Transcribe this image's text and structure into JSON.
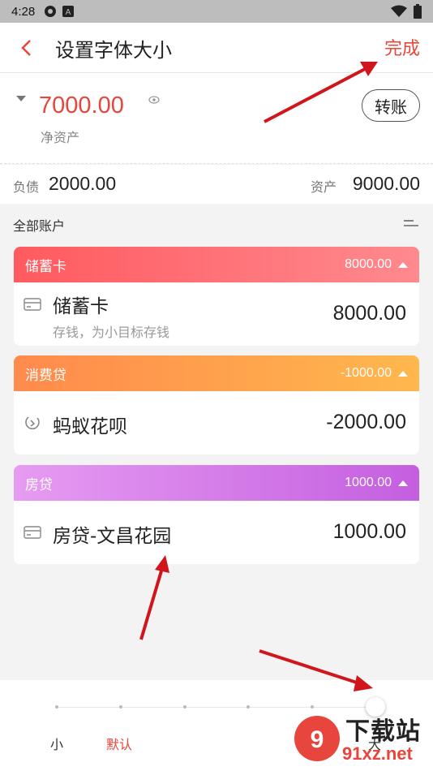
{
  "status_bar": {
    "time": "4:28"
  },
  "app_bar": {
    "title": "设置字体大小",
    "done_label": "完成"
  },
  "summary": {
    "net_assets_value": "7000.00",
    "net_assets_label": "净资产",
    "transfer_label": "转账"
  },
  "totals": {
    "liabilities_label": "负债",
    "liabilities_value": "2000.00",
    "assets_label": "资产",
    "assets_value": "9000.00"
  },
  "accounts_section": {
    "label": "全部账户"
  },
  "groups": [
    {
      "name": "储蓄卡",
      "amount": "8000.00",
      "color_from": "#ff5a5f",
      "color_to": "#ff8a8f",
      "account": {
        "name": "储蓄卡",
        "subtitle": "存钱，为小目标存钱",
        "value": "8000.00",
        "icon": "card-icon"
      }
    },
    {
      "name": "消费贷",
      "amount": "-1000.00",
      "color_from": "#ff8a4d",
      "color_to": "#ffb84d",
      "account": {
        "name": "蚂蚁花呗",
        "subtitle": "",
        "value": "-2000.00",
        "icon": "huabei-icon"
      }
    },
    {
      "name": "房贷",
      "amount": "1000.00",
      "color_from": "#e69cf2",
      "color_to": "#c45fe0",
      "account": {
        "name": "房贷-文昌花园",
        "subtitle": "",
        "value": "1000.00",
        "icon": "card-icon"
      }
    }
  ],
  "font_size_panel": {
    "labels": [
      "小",
      "默认",
      "大"
    ],
    "selected_index": 2,
    "steps": 7,
    "active_label_color": "#e8453c"
  },
  "watermark": {
    "top": "下载站",
    "bottom": "91xz.net"
  },
  "colors": {
    "accent": "#e8453c",
    "arrow": "#d0161c"
  }
}
